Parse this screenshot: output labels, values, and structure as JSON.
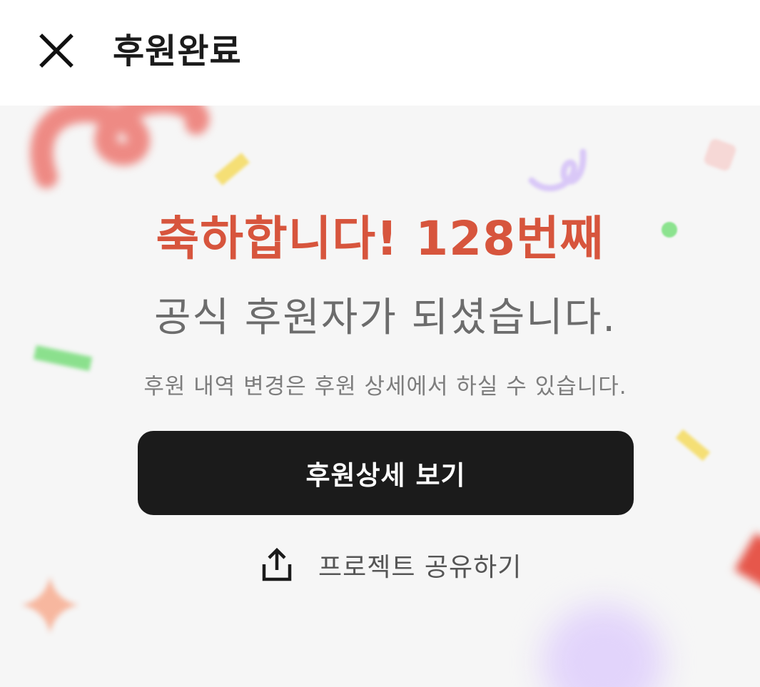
{
  "header": {
    "close_icon": "close-icon",
    "title": "후원완료"
  },
  "main": {
    "headline": "축하합니다! 128번째",
    "subhead": "공식 후원자가 되셨습니다.",
    "note": "후원 내역 변경은 후원 상세에서 하실 수 있습니다.",
    "primary_button_label": "후원상세 보기",
    "share": {
      "icon": "share-icon",
      "label": "프로젝트 공유하기"
    }
  },
  "colors": {
    "accent": "#d7553d",
    "button_bg": "#1b1b1b",
    "background": "#f6f6f6"
  }
}
